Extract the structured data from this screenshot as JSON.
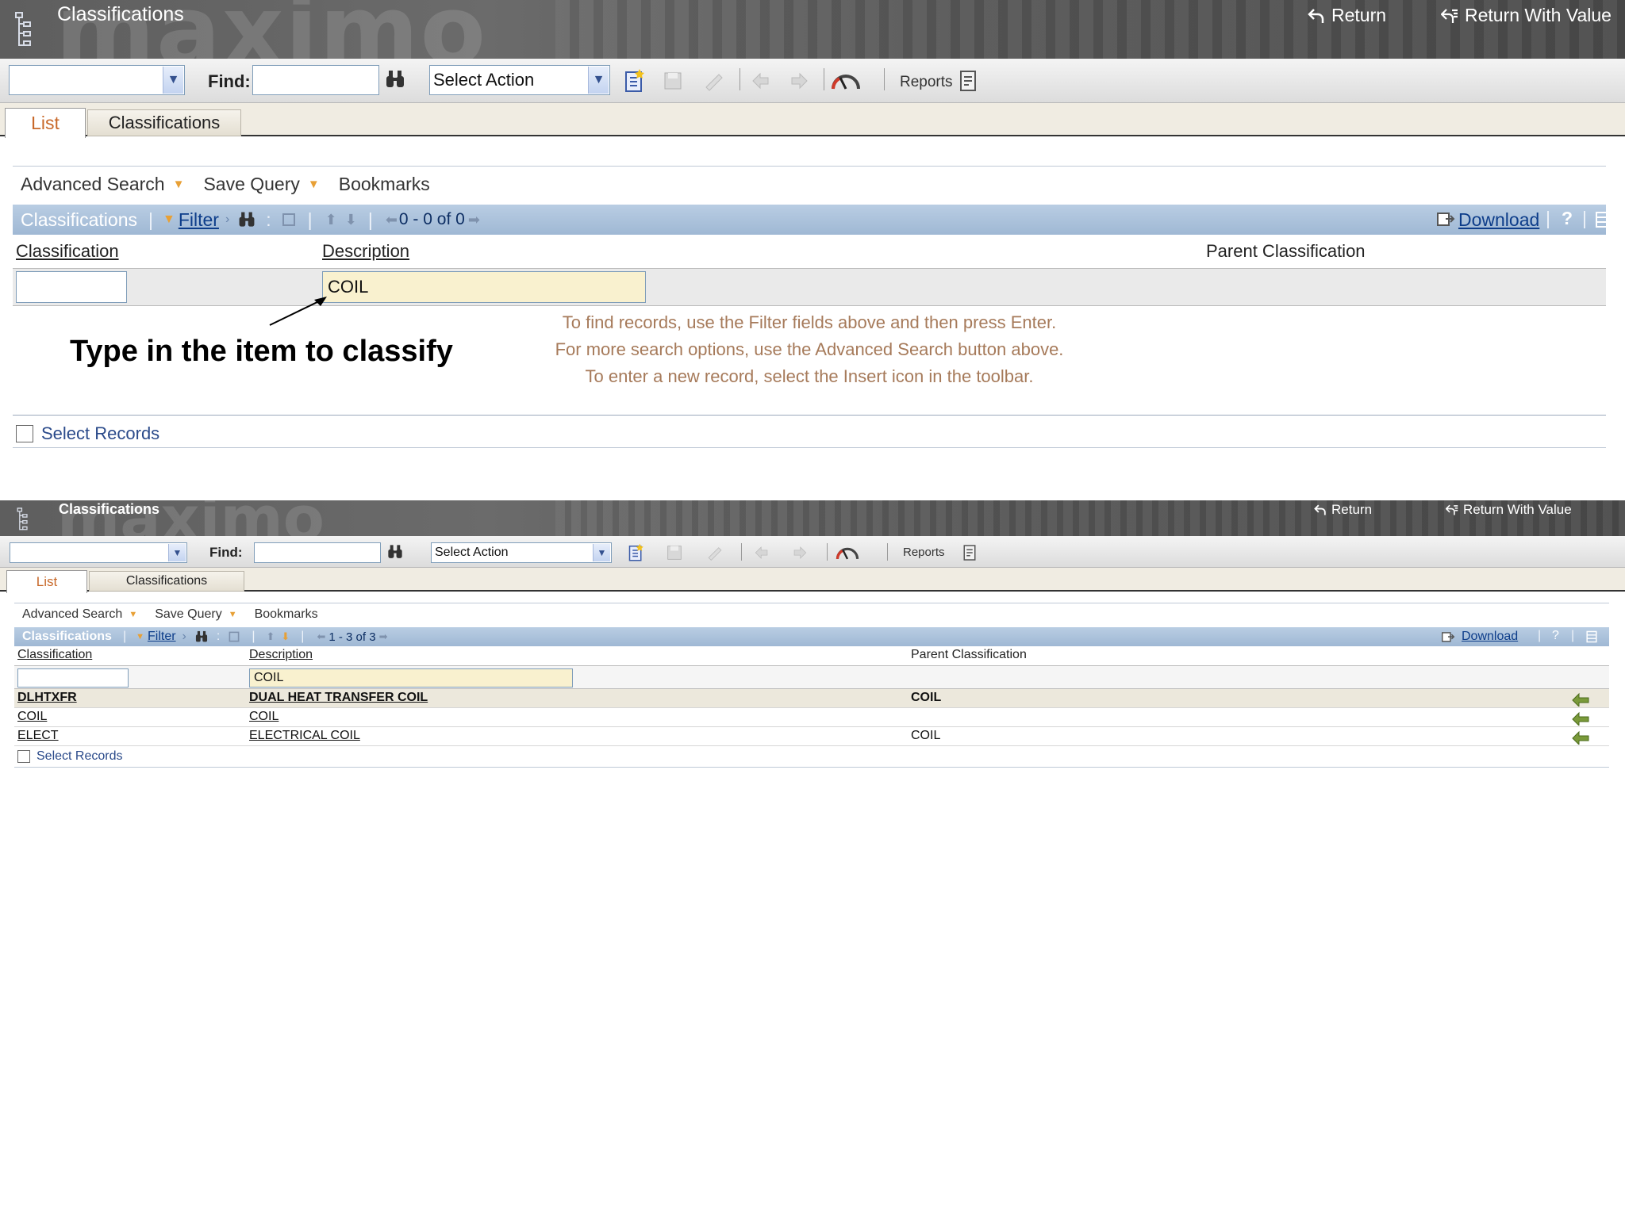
{
  "app": {
    "title": "Classifications",
    "wordmark": "maximo",
    "return_label": "Return",
    "return_with_value_label": "Return With Value"
  },
  "toolbar": {
    "find_label": "Find:",
    "select_action": "Select Action",
    "reports_label": "Reports"
  },
  "tabs": [
    {
      "label": "List",
      "active": true
    },
    {
      "label": "Classifications",
      "active": false
    }
  ],
  "query_bar": {
    "advanced_search": "Advanced Search",
    "save_query": "Save Query",
    "bookmarks": "Bookmarks"
  },
  "table": {
    "title": "Classifications",
    "filter_label": "Filter",
    "download_label": "Download",
    "help_label": "?",
    "columns": [
      "Classification",
      "Description",
      "Parent Classification"
    ]
  },
  "panel1": {
    "filter_description": "COIL",
    "paging": "0 - 0 of 0",
    "hint_lines": [
      "To find records, use the Filter fields above and then press Enter.",
      "For more search options, use the Advanced Search button above.",
      "To enter a new record, select the Insert icon in the toolbar."
    ],
    "annotation": "Type in the item to classify",
    "select_records": "Select Records"
  },
  "panel2": {
    "filter_description": "COIL",
    "paging": "1 - 3 of 3",
    "rows": [
      {
        "classification": "DLHTXFR",
        "description": "DUAL HEAT TRANSFER COIL",
        "parent": "COIL"
      },
      {
        "classification": "COIL",
        "description": "COIL",
        "parent": ""
      },
      {
        "classification": "ELECT",
        "description": "ELECTRICAL COIL",
        "parent": "COIL"
      }
    ],
    "select_records": "Select Records"
  },
  "colors": {
    "titlebar": "#5e5e5e",
    "table_header": "#a9c0da",
    "active_tab_text": "#c8692a",
    "filter_highlight": "#f9f1cf",
    "link": "#0d3d8a"
  }
}
